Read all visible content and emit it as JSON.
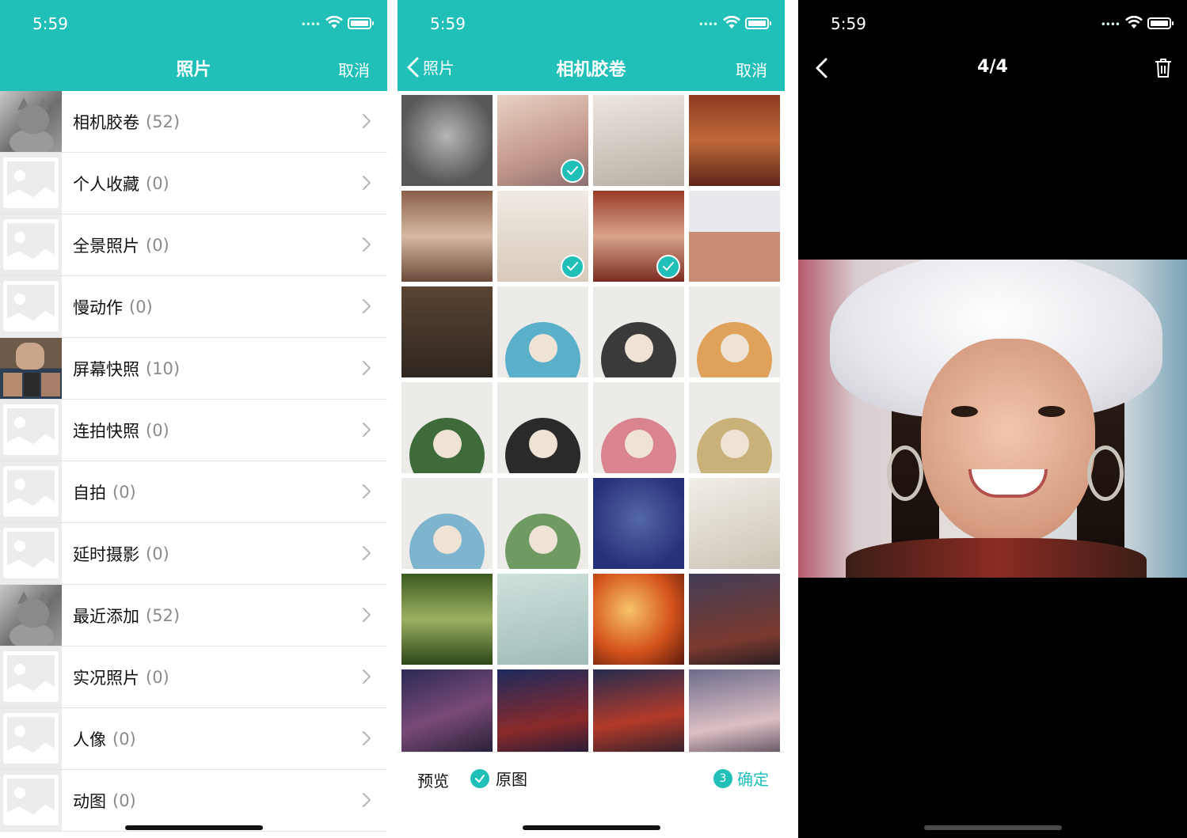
{
  "status": {
    "time": "5:59"
  },
  "screen1": {
    "title": "照片",
    "cancel": "取消",
    "albums": [
      {
        "name": "相机胶卷",
        "count": "(52)",
        "thumb": "cat"
      },
      {
        "name": "个人收藏",
        "count": "(0)",
        "thumb": "placeholder"
      },
      {
        "name": "全景照片",
        "count": "(0)",
        "thumb": "placeholder"
      },
      {
        "name": "慢动作",
        "count": "(0)",
        "thumb": "placeholder"
      },
      {
        "name": "屏幕快照",
        "count": "(10)",
        "thumb": "screenshot"
      },
      {
        "name": "连拍快照",
        "count": "(0)",
        "thumb": "placeholder"
      },
      {
        "name": "自拍",
        "count": "(0)",
        "thumb": "placeholder"
      },
      {
        "name": "延时摄影",
        "count": "(0)",
        "thumb": "placeholder"
      },
      {
        "name": "最近添加",
        "count": "(52)",
        "thumb": "cat"
      },
      {
        "name": "实况照片",
        "count": "(0)",
        "thumb": "placeholder"
      },
      {
        "name": "人像",
        "count": "(0)",
        "thumb": "placeholder"
      },
      {
        "name": "动图",
        "count": "(0)",
        "thumb": "placeholder"
      }
    ]
  },
  "screen2": {
    "back_label": "照片",
    "title": "相机胶卷",
    "cancel": "取消",
    "photos": [
      {
        "style": "p-gray",
        "selected": false
      },
      {
        "style": "p-skin",
        "selected": true
      },
      {
        "style": "p-pale",
        "selected": false
      },
      {
        "style": "p-warm",
        "selected": false
      },
      {
        "style": "p-brown",
        "selected": false
      },
      {
        "style": "p-white",
        "selected": true
      },
      {
        "style": "p-red",
        "selected": true
      },
      {
        "style": "p-hat",
        "selected": false
      },
      {
        "style": "p-dark",
        "selected": false
      },
      {
        "style": "p-paper",
        "art": "#5ab0c8",
        "selected": false
      },
      {
        "style": "p-paper",
        "art": "#3a3a3a",
        "selected": false
      },
      {
        "style": "p-paper",
        "art": "#e0a15a",
        "selected": false
      },
      {
        "style": "p-paper",
        "art": "#3f6b3a",
        "selected": false
      },
      {
        "style": "p-paper",
        "art": "#2a2a2a",
        "selected": false
      },
      {
        "style": "p-paper",
        "art": "#d9848f",
        "selected": false
      },
      {
        "style": "p-paper",
        "art": "#c9b27a",
        "selected": false
      },
      {
        "style": "p-paper",
        "art": "#7fb4cf",
        "selected": false
      },
      {
        "style": "p-paper",
        "art": "#6f9a62",
        "selected": false
      },
      {
        "style": "p-blue",
        "selected": false
      },
      {
        "style": "p-ink",
        "selected": false
      },
      {
        "style": "p-green",
        "selected": false
      },
      {
        "style": "p-lotus",
        "selected": false
      },
      {
        "style": "p-fire",
        "selected": false
      },
      {
        "style": "p-night",
        "selected": false
      },
      {
        "style": "p-purple",
        "selected": false
      },
      {
        "style": "p-navy",
        "selected": false
      },
      {
        "style": "p-rose",
        "selected": false
      },
      {
        "style": "p-blush",
        "selected": false
      }
    ],
    "bottom": {
      "preview": "预览",
      "original": "原图",
      "confirm_count": "3",
      "confirm": "确定"
    }
  },
  "screen3": {
    "counter": "4/4"
  },
  "colors": {
    "accent": "#20bfb8",
    "navbar_bg": "#20bfb8",
    "viewer_bg": "#000000"
  }
}
